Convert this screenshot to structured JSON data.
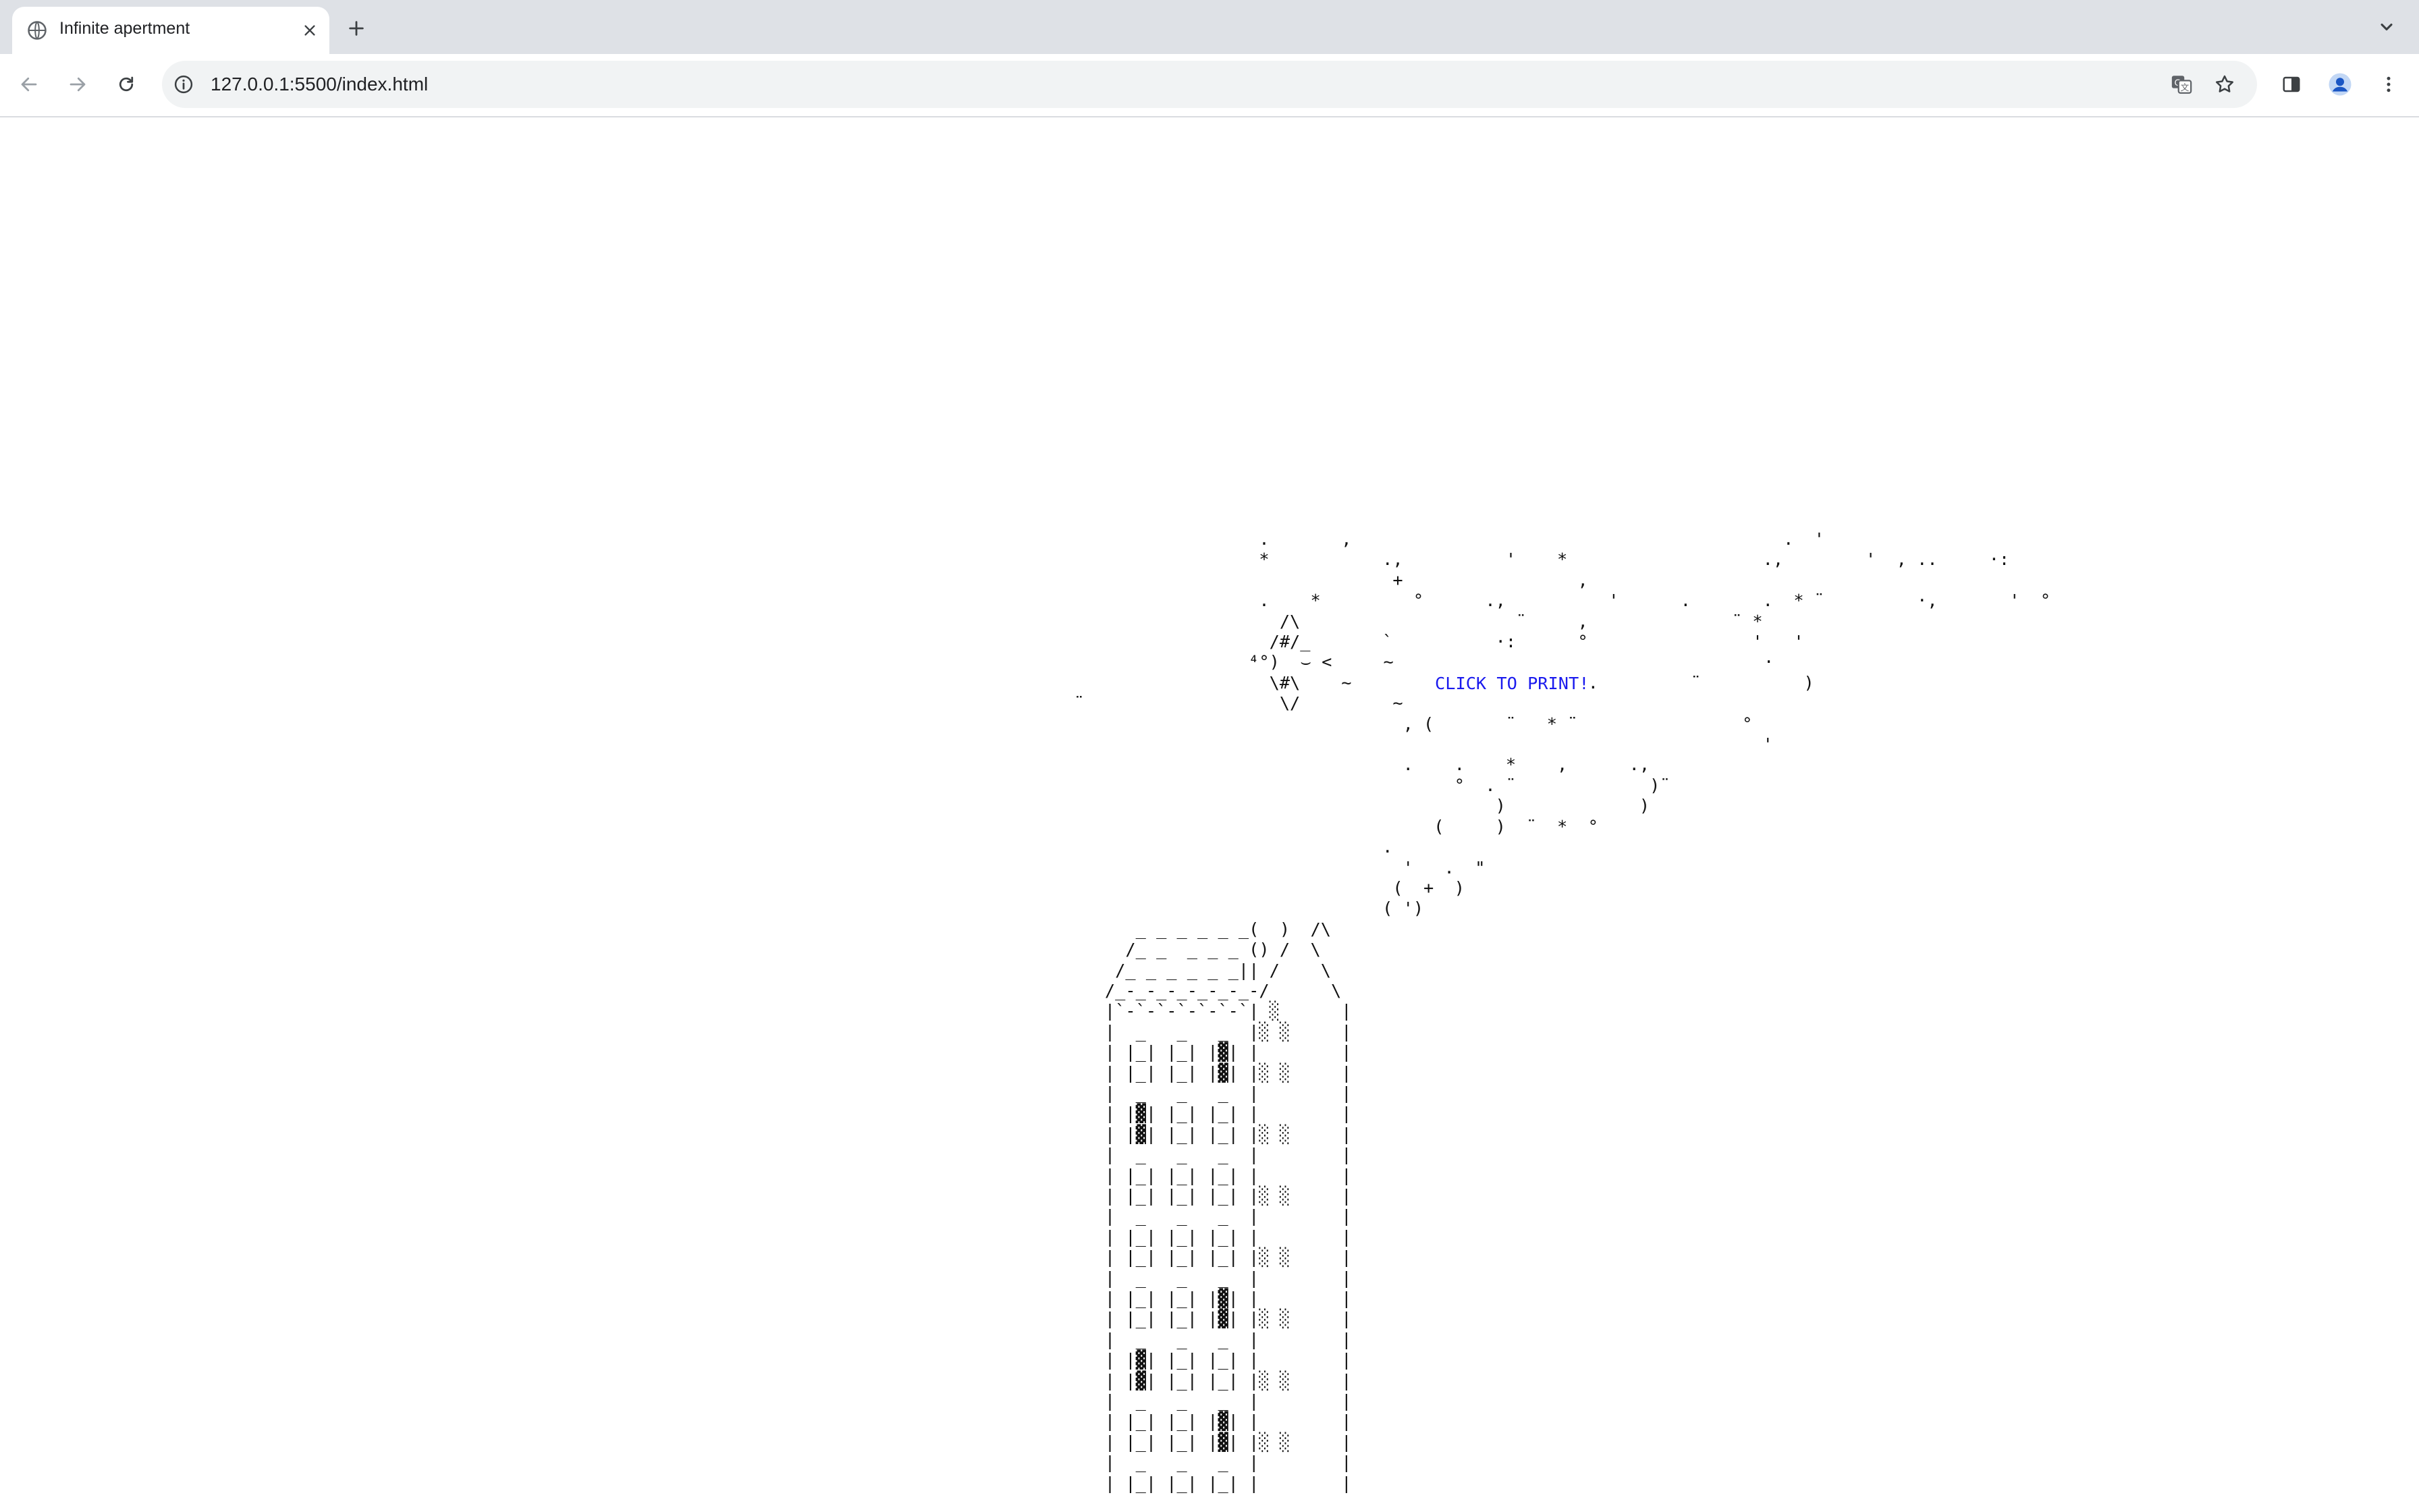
{
  "browser": {
    "tab": {
      "title": "Infinite apertment",
      "favicon": "globe-icon"
    },
    "new_tab_icon": "plus-icon",
    "tab_search_icon": "chevron-down-icon",
    "address": {
      "url": "127.0.0.1:5500/index.html",
      "site_info_icon": "info-icon"
    },
    "toolbar_icons": [
      "back-arrow-icon",
      "forward-arrow-icon",
      "reload-icon",
      "translate-icon",
      "star-icon",
      "side-panel-icon",
      "profile-icon",
      "more-vert-icon"
    ]
  },
  "page": {
    "print_link": "CLICK TO PRINT!",
    "scene_art": "                   .       ,                                          .  '\n                   *           .,          '    *                   .,        '  , ..     ·:\n                                +                 ,                            \n                   .    *         °      .,          '      .       .  * ¨         ·,       '  °\n                     /\\                     ¨     ,              ¨ *\n                    /#/_       `          ·:      °                '   '\n                  ⁴°)  ⌣ <     ~                                    ·\n                    \\#\\    ~              °       ,.         ¨          )\n ¨                   \\/         ~\n                                 , (       ¨   * ¨                °\n                                                                    '\n                                 .    .    *    ,      .,\n                                      °  . ¨             )¨\n                                          )             )\n                                    (     )  ¨  *  °\n                               .\n                                 '   .  \"\n                                (  +  )\n                               ( ')\n       _ _ _ _ _ _(  )  /\\\n      /_ _  _ _ _ () /  \\\n     /_ _ _ _ _ _|| /    \\\n    /_-_-_-_-_-_-_-/      \\\n    |`-`-`-`-`-`-`| ░      |\n    |  _   _   _  |░ ░     |\n    | |_| |_| |▓| |        |\n    | |_| |_| |▓| |░ ░     |\n    |  _   _   _  |        |\n    | |▓| |_| |_| |        |\n    | |▓| |_| |_| |░ ░     |\n    |  _   _   _  |        |\n    | |_| |_| |_| |        |\n    | |_| |_| |_| |░ ░     |\n    |  _   _   _  |        |\n    | |_| |_| |_| |        |\n    | |_| |_| |_| |░ ░     |\n    |  _   _   _  |        |\n    | |_| |_| |▓| |        |\n    | |_| |_| |▓| |░ ░     |\n    |  _   _   _  |        |\n    | |▓| |_| |_| |        |\n    | |▓| |_| |_| |░ ░     |\n    |  _   _   _  |        |\n    | |_| |_| |▓| |        |\n    | |_| |_| |▓| |░ ░     |\n    |  _   _   _  |        |\n    | |_| |_| |_| |        |"
  }
}
